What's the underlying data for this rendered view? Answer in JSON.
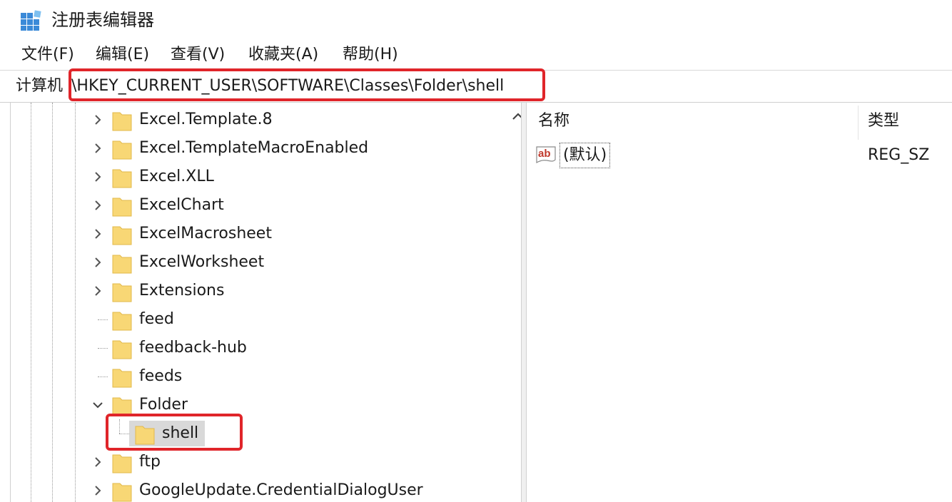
{
  "window": {
    "title": "注册表编辑器",
    "icon": "registry-editor-icon"
  },
  "menu": {
    "items": [
      "文件(F)",
      "编辑(E)",
      "查看(V)",
      "收藏夹(A)",
      "帮助(H)"
    ]
  },
  "address": {
    "prefix": "计算机",
    "path": "\\HKEY_CURRENT_USER\\SOFTWARE\\Classes\\Folder\\shell"
  },
  "tree": {
    "rows": [
      {
        "label": "Excel.Template.8",
        "expander": "collapsed"
      },
      {
        "label": "Excel.TemplateMacroEnabled",
        "expander": "collapsed"
      },
      {
        "label": "Excel.XLL",
        "expander": "collapsed"
      },
      {
        "label": "ExcelChart",
        "expander": "collapsed"
      },
      {
        "label": "ExcelMacrosheet",
        "expander": "collapsed"
      },
      {
        "label": "ExcelWorksheet",
        "expander": "collapsed"
      },
      {
        "label": "Extensions",
        "expander": "collapsed"
      },
      {
        "label": "feed",
        "expander": "none"
      },
      {
        "label": "feedback-hub",
        "expander": "none"
      },
      {
        "label": "feeds",
        "expander": "none"
      },
      {
        "label": "Folder",
        "expander": "expanded"
      },
      {
        "label": "shell",
        "expander": "none",
        "selected": true
      },
      {
        "label": "ftp",
        "expander": "collapsed"
      },
      {
        "label": "GoogleUpdate.CredentialDialogUser",
        "expander": "collapsed"
      }
    ]
  },
  "list": {
    "columns": [
      "名称",
      "类型"
    ],
    "rows": [
      {
        "name": "(默认)",
        "type": "REG_SZ",
        "icon": "string-value-icon"
      }
    ]
  },
  "colors": {
    "highlight": "#e0252a",
    "folder": "#f8d775",
    "selection": "#d9d9d9"
  }
}
